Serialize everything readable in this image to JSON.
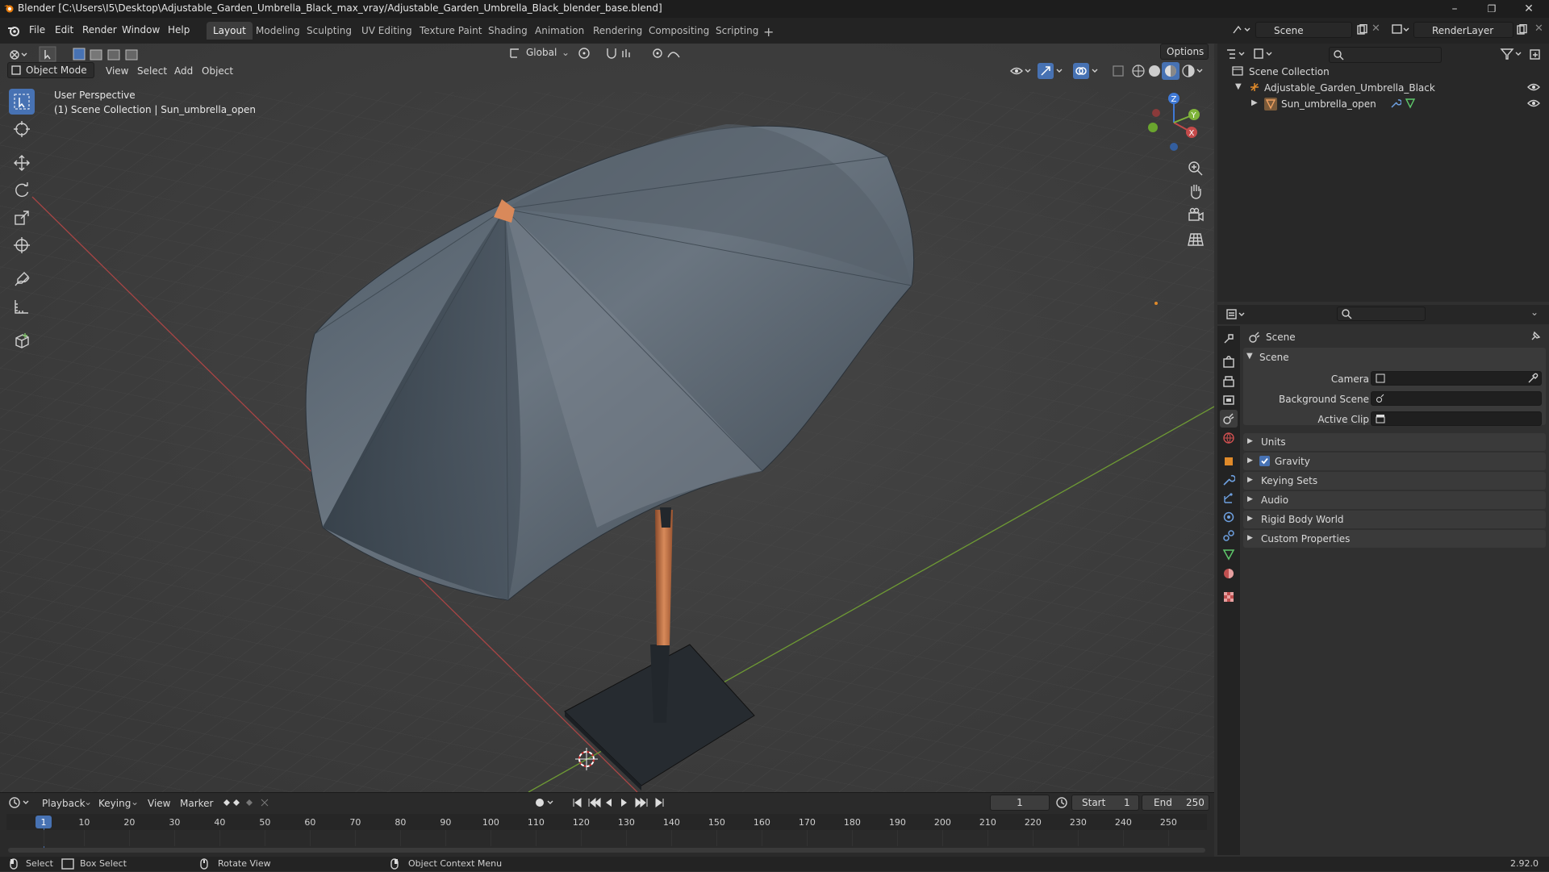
{
  "window": {
    "title": "Blender [C:\\Users\\I5\\Desktop\\Adjustable_Garden_Umbrella_Black_max_vray/Adjustable_Garden_Umbrella_Black_blender_base.blend]",
    "version": "2.92.0"
  },
  "menu": [
    "File",
    "Edit",
    "Render",
    "Window",
    "Help"
  ],
  "workspaces": [
    {
      "label": "Layout",
      "active": true
    },
    {
      "label": "Modeling"
    },
    {
      "label": "Sculpting"
    },
    {
      "label": "UV Editing"
    },
    {
      "label": "Texture Paint"
    },
    {
      "label": "Shading"
    },
    {
      "label": "Animation"
    },
    {
      "label": "Rendering"
    },
    {
      "label": "Compositing"
    },
    {
      "label": "Scripting"
    }
  ],
  "header": {
    "scene": "Scene",
    "render_layer": "RenderLayer"
  },
  "viewport": {
    "mode": "Object Mode",
    "menus": [
      "View",
      "Select",
      "Add",
      "Object"
    ],
    "orientation": "Global",
    "options": "Options",
    "overlay_line1": "User Perspective",
    "overlay_line2": "(1) Scene Collection | Sun_umbrella_open"
  },
  "outliner": {
    "root": "Scene Collection",
    "items": [
      {
        "label": "Adjustable_Garden_Umbrella_Black",
        "depth": 1
      },
      {
        "label": "Sun_umbrella_open",
        "depth": 2
      }
    ]
  },
  "properties": {
    "context": "Scene",
    "panel_title": "Scene",
    "fields": [
      {
        "label": "Camera"
      },
      {
        "label": "Background Scene"
      },
      {
        "label": "Active Clip"
      }
    ],
    "sections": [
      "Units",
      "Gravity",
      "Keying Sets",
      "Audio",
      "Rigid Body World",
      "Custom Properties"
    ],
    "gravity_checked": true
  },
  "timeline": {
    "menus": [
      "Playback",
      "Keying",
      "View",
      "Marker"
    ],
    "current_frame": "1",
    "start_label": "Start",
    "start": "1",
    "end_label": "End",
    "end": "250",
    "ticks": [
      "1",
      "10",
      "20",
      "30",
      "40",
      "50",
      "60",
      "70",
      "80",
      "90",
      "100",
      "110",
      "120",
      "130",
      "140",
      "150",
      "160",
      "170",
      "180",
      "190",
      "200",
      "210",
      "220",
      "230",
      "240",
      "250"
    ]
  },
  "statusbar": {
    "select": "Select",
    "box_select": "Box Select",
    "rotate": "Rotate View",
    "context_menu": "Object Context Menu"
  },
  "colors": {
    "accent": "#4772b3",
    "x_axis": "#c44a4a",
    "y_axis": "#7fb33a",
    "z_axis": "#3f79d6"
  }
}
